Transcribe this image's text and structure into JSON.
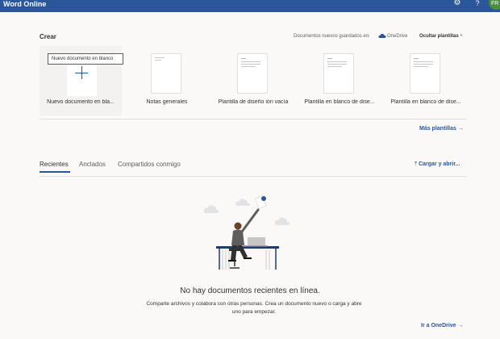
{
  "app": {
    "title": "Word Online",
    "avatar_initials": "FR"
  },
  "icons": {
    "settings": "gear-icon",
    "help": "question-icon",
    "onedrive": "cloud-icon",
    "upload": "upload-arrow-icon",
    "more": "arrow-right-icon"
  },
  "colors": {
    "brand": "#2b579a",
    "background": "#faf9f8",
    "avatar": "#4a8f3e"
  },
  "create": {
    "heading": "Crear",
    "saved_in_label": "Documentos nuevos guardados en:",
    "onedrive_label": "OneDrive",
    "hide_templates": "Ocultar plantillas",
    "tooltip": "Nuevo documento en blanco",
    "templates": [
      {
        "label": "Nuevo documento en bla..."
      },
      {
        "label": "Notas generales"
      },
      {
        "label": "Plantilla de diseño ión vacía"
      },
      {
        "label": "Plantilla en blanco de dise..."
      },
      {
        "label": "Plantilla en blanco de dise..."
      }
    ],
    "more_templates": "Más plantillas"
  },
  "tabs": [
    {
      "label": "Recientes",
      "active": true
    },
    {
      "label": "Anclados",
      "active": false
    },
    {
      "label": "Compartidos conmigo",
      "active": false
    }
  ],
  "upload_label": "Cargar y abrir...",
  "empty": {
    "title": "No hay documentos recientes en línea.",
    "description": "Comparte archivos y colabora con otras personas. Crea un documento nuevo o carga y abre uno para empezar.",
    "goto_onedrive": "Ir a OneDrive"
  }
}
